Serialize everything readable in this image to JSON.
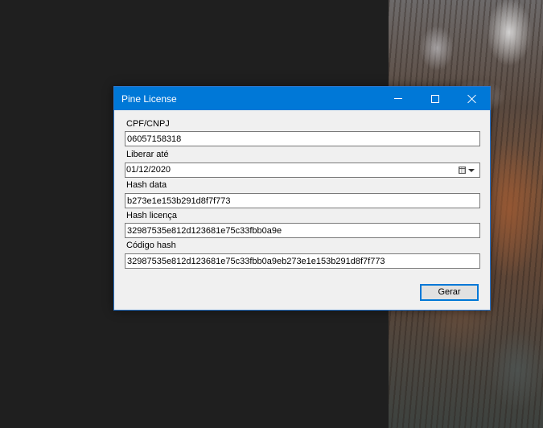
{
  "window": {
    "title": "Pine License"
  },
  "fields": {
    "cpf": {
      "label": "CPF/CNPJ",
      "value": "06057158318"
    },
    "liberar": {
      "label": "Liberar até",
      "value": "01/12/2020"
    },
    "hash_data": {
      "label": "Hash data",
      "value": "b273e1e153b291d8f7f773"
    },
    "hash_licenca": {
      "label": "Hash licença",
      "value": "32987535e812d123681e75c33fbb0a9e"
    },
    "codigo_hash": {
      "label": "Código hash",
      "value": "32987535e812d123681e75c33fbb0a9eb273e1e153b291d8f7f773"
    }
  },
  "actions": {
    "gerar_label": "Gerar"
  },
  "colors": {
    "titlebar": "#0078d7",
    "window_bg": "#f0f0f0",
    "desktop_bg": "#1f1f1f"
  },
  "icons": {
    "minimize": "minimize-icon",
    "maximize": "maximize-icon",
    "close": "close-icon",
    "calendar": "calendar-icon",
    "dropdown": "chevron-down-icon"
  }
}
